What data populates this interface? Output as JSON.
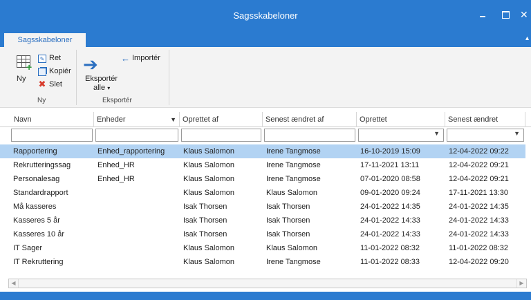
{
  "window": {
    "title": "Sagsskabeloner"
  },
  "tabs": [
    {
      "label": "Sagsskabeloner"
    }
  ],
  "ribbon": {
    "new_label": "Ny",
    "edit_label": "Ret",
    "copy_label": "Kopiér",
    "delete_label": "Slet",
    "group_new": "Ny",
    "export_all_line1": "Eksportér",
    "export_all_line2": "alle",
    "import_label": "Importér",
    "group_export": "Eksportér"
  },
  "grid": {
    "columns": [
      "Navn",
      "Enheder",
      "Oprettet af",
      "Senest ændret af",
      "Oprettet",
      "Senest ændret"
    ],
    "selected_row": 0,
    "rows": [
      [
        "Rapportering",
        "Enhed_rapportering",
        "Klaus Salomon",
        "Irene Tangmose",
        "16-10-2019 15:09",
        "12-04-2022 09:22"
      ],
      [
        "Rekrutteringssag",
        "Enhed_HR",
        "Klaus Salomon",
        "Irene Tangmose",
        "17-11-2021 13:11",
        "12-04-2022 09:21"
      ],
      [
        "Personalesag",
        "Enhed_HR",
        "Klaus Salomon",
        "Irene Tangmose",
        "07-01-2020 08:58",
        "12-04-2022 09:21"
      ],
      [
        "Standardrapport",
        "",
        "Klaus Salomon",
        "Klaus Salomon",
        "09-01-2020 09:24",
        "17-11-2021 13:30"
      ],
      [
        "Må kasseres",
        "",
        "Isak Thorsen",
        "Isak Thorsen",
        "24-01-2022 14:35",
        "24-01-2022 14:35"
      ],
      [
        "Kasseres 5 år",
        "",
        "Isak Thorsen",
        "Isak Thorsen",
        "24-01-2022 14:33",
        "24-01-2022 14:33"
      ],
      [
        "Kasseres 10 år",
        "",
        "Isak Thorsen",
        "Isak Thorsen",
        "24-01-2022 14:33",
        "24-01-2022 14:33"
      ],
      [
        "IT Sager",
        "",
        "Klaus Salomon",
        "Klaus Salomon",
        "11-01-2022 08:32",
        "11-01-2022 08:32"
      ],
      [
        "IT Rekruttering",
        "",
        "Klaus Salomon",
        "Irene Tangmose",
        "11-01-2022 08:33",
        "12-04-2022 09:20"
      ]
    ]
  },
  "colors": {
    "accent": "#2b7bd0",
    "selection": "#b2d3f3"
  },
  "icons": {
    "new": "table-add-icon",
    "edit": "edit-icon",
    "copy": "copy-icon",
    "delete": "delete-x-icon",
    "export": "arrow-right-icon",
    "import": "arrow-left-icon"
  }
}
